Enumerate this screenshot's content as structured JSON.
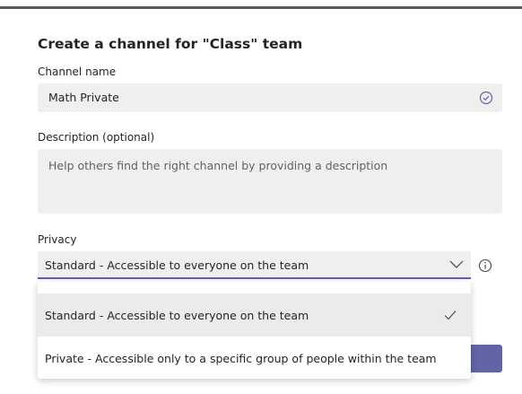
{
  "dialog": {
    "title": "Create a channel for \"Class\" team"
  },
  "channel_name": {
    "label": "Channel name",
    "value": "Math Private",
    "valid_icon": "check-circle-icon"
  },
  "description": {
    "label": "Description (optional)",
    "placeholder": "Help others find the right channel by providing a description"
  },
  "privacy": {
    "label": "Privacy",
    "selected": "Standard - Accessible to everyone on the team",
    "options": [
      {
        "label": "Standard - Accessible to everyone on the team",
        "selected": true
      },
      {
        "label": "Private - Accessible only to a specific group of people within the team",
        "selected": false
      }
    ],
    "info_icon": "info-icon"
  },
  "colors": {
    "accent": "#6264a7",
    "focus_underline": "#5b5fc7",
    "field_background": "#f0efee",
    "hover_option": "#edebe9"
  }
}
